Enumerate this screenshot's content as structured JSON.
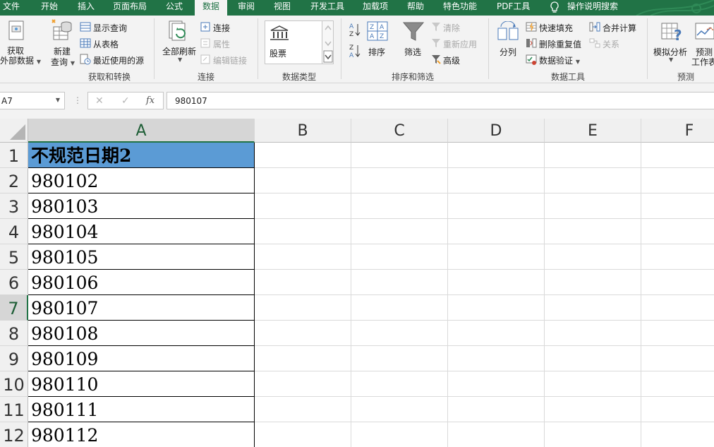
{
  "tabs": [
    "文件",
    "开始",
    "插入",
    "页面布局",
    "公式",
    "数据",
    "审阅",
    "视图",
    "开发工具",
    "加载项",
    "帮助",
    "特色功能",
    "PDF工具",
    "操作说明搜索"
  ],
  "active_tab": "数据",
  "ribbon": {
    "get_transform": {
      "get_data_line1": "获取",
      "get_data_line2": "外部数据",
      "new_query_line1": "新建",
      "new_query_line2": "查询",
      "show_queries": "显示查询",
      "from_table": "从表格",
      "recent_sources": "最近使用的源",
      "label": "获取和转换"
    },
    "connections": {
      "refresh_all": "全部刷新",
      "connections": "连接",
      "properties": "属性",
      "edit_links": "编辑链接",
      "label": "连接"
    },
    "data_types": {
      "stocks": "股票",
      "label": "数据类型"
    },
    "sort_filter": {
      "sort": "排序",
      "filter": "筛选",
      "clear": "清除",
      "reapply": "重新应用",
      "advanced": "高级",
      "label": "排序和筛选"
    },
    "data_tools": {
      "text_to_columns": "分列",
      "flash_fill": "快速填充",
      "remove_duplicates": "删除重复值",
      "data_validation": "数据验证",
      "consolidate": "合并计算",
      "relationships": "关系",
      "label": "数据工具"
    },
    "forecast": {
      "what_if": "模拟分析",
      "forecast_sheet_line1": "预测",
      "forecast_sheet_line2": "工作表",
      "label": "预测"
    }
  },
  "formula_bar": {
    "name_box": "A7",
    "formula": "980107",
    "cancel_icon": "✕",
    "enter_icon": "✓",
    "fx_label": "fx"
  },
  "sheet": {
    "columns": [
      "A",
      "B",
      "C",
      "D",
      "E",
      "F"
    ],
    "rows": [
      "1",
      "2",
      "3",
      "4",
      "5",
      "6",
      "7",
      "8",
      "9",
      "10",
      "11",
      "12"
    ],
    "column_a_values": [
      "不规范日期2",
      "980102",
      "980103",
      "980104",
      "980105",
      "980106",
      "980107",
      "980108",
      "980109",
      "980110",
      "980111",
      "980112"
    ],
    "selected_column": "A",
    "selected_row": "7"
  },
  "colors": {
    "accent": "#217346",
    "header_fill": "#5b9bd5"
  }
}
